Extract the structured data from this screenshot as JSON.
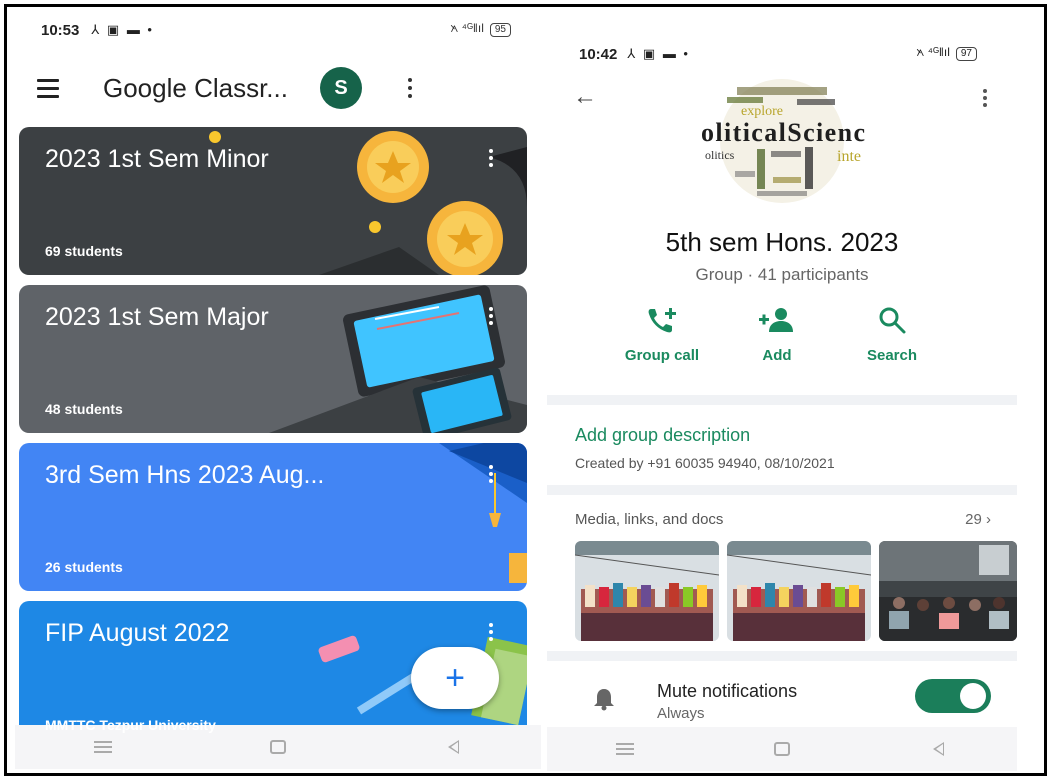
{
  "left_phone": {
    "status": {
      "time": "10:53",
      "glyphs": "⅄ ▣ ▬ •",
      "network": "᭶ ⁴ᴳǁıl",
      "battery": "95"
    },
    "appbar": {
      "title": "Google Classr...",
      "avatar_letter": "S"
    },
    "classes": [
      {
        "title": "2023 1st Sem Minor",
        "students": "69 students",
        "color": "#3c4043"
      },
      {
        "title": "2023 1st Sem Major",
        "students": "48 students",
        "color": "#5f6368"
      },
      {
        "title": "3rd Sem Hns 2023 Aug...",
        "students": "26 students",
        "color": "#4285f4"
      },
      {
        "title": "FIP August 2022",
        "students": "MMTTC Tezpur University",
        "color": "#1e88e5"
      }
    ],
    "fab_label": "+"
  },
  "right_phone": {
    "status": {
      "time": "10:42",
      "glyphs": "⅄ ▣ ▬ •",
      "network": "᭶ ⁴ᴳǁıl",
      "battery": "97"
    },
    "group_name": "5th sem Hons. 2023",
    "group_meta": "Group · 41 participants",
    "actions": [
      {
        "label": "Group call",
        "icon": "group-call-icon"
      },
      {
        "label": "Add",
        "icon": "add-person-icon"
      },
      {
        "label": "Search",
        "icon": "search-icon"
      }
    ],
    "add_description": "Add group description",
    "created_by": "Created by +91 60035 94940, 08/10/2021",
    "media_label": "Media, links, and docs",
    "media_count": "29 ›",
    "mute_title": "Mute notifications",
    "mute_sub": "Always",
    "mute_on": true,
    "logo_words": {
      "main": "oliticalScienc",
      "explore": "explore",
      "side_left": "olitics",
      "side_right": "inte"
    },
    "accent_color": "#1a8a5f"
  }
}
